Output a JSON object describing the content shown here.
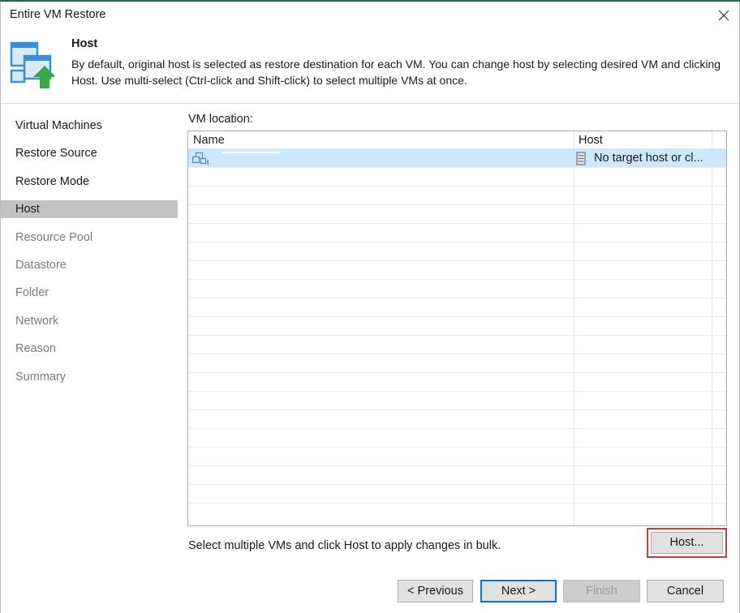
{
  "window": {
    "title": "Entire VM Restore"
  },
  "header": {
    "title": "Host",
    "description": "By default, original host is selected as restore destination for each VM. You can change host by selecting desired VM and clicking Host. Use multi-select (Ctrl-click and Shift-click) to select multiple VMs at once."
  },
  "nav": {
    "items": [
      {
        "label": "Virtual Machines",
        "state": "done"
      },
      {
        "label": "Restore Source",
        "state": "done"
      },
      {
        "label": "Restore Mode",
        "state": "done"
      },
      {
        "label": "Host",
        "state": "active"
      },
      {
        "label": "Resource Pool",
        "state": "pending"
      },
      {
        "label": "Datastore",
        "state": "pending"
      },
      {
        "label": "Folder",
        "state": "pending"
      },
      {
        "label": "Network",
        "state": "pending"
      },
      {
        "label": "Reason",
        "state": "pending"
      },
      {
        "label": "Summary",
        "state": "pending"
      }
    ]
  },
  "content": {
    "location_label": "VM location:",
    "table": {
      "columns": [
        "Name",
        "Host"
      ],
      "rows": [
        {
          "name": "",
          "host": "No target host or cl...",
          "selected": true
        }
      ],
      "empty_row_count": 18
    },
    "hint": "Select multiple VMs and click Host to apply changes in bulk.",
    "host_button": "Host..."
  },
  "footer": {
    "previous": "< Previous",
    "next": "Next >",
    "finish": "Finish",
    "cancel": "Cancel"
  },
  "colors": {
    "selected_row": "#cce8ff",
    "active_nav": "#c3c3c3",
    "highlight_box": "#d9343a",
    "default_button_border": "#0078d7",
    "arrow_green": "#3aa648",
    "vm_icon_blue": "#3b8fd4"
  },
  "icons": {
    "close": "close-icon",
    "header": "restore-to-host-icon",
    "vm": "vm-icon",
    "host": "host-server-icon"
  }
}
